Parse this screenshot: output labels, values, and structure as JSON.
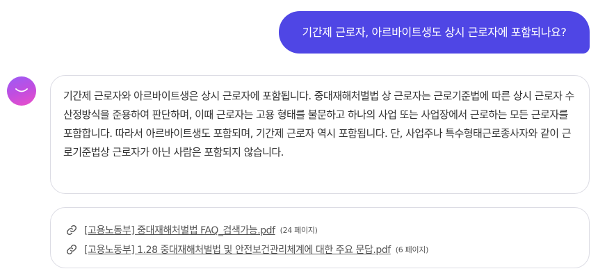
{
  "user_message": "기간제 근로자, 아르바이트생도 상시 근로자에 포함되나요?",
  "assistant": {
    "avatar_icon": "smile-icon",
    "answer": "기간제 근로자와 아르바이트생은 상시 근로자에 포함됩니다. 중대재해처벌법 상 근로자는 근로기준법에 따른 상시 근로자 수 산정방식을 준용하여 판단하며, 이때 근로자는 고용 형태를 불문하고 하나의 사업 또는 사업장에서 근로하는 모든 근로자를 포함합니다. 따라서 아르바이트생도 포함되며, 기간제 근로자 역시 포함됩니다. 단, 사업주나 특수형태근로종사자와 같이 근로기준법상 근로자가 아닌 사람은 포함되지 않습니다."
  },
  "sources": [
    {
      "title": "[고용노동부] 중대재해처벌법 FAQ_검색가능.pdf",
      "pages": "(24 페이지)",
      "icon": "link-icon"
    },
    {
      "title": "[고용노동부] 1.28 중대재해처벌법 및 안전보건관리체계에 대한 주요 문답.pdf",
      "pages": "(6 페이지)",
      "icon": "link-icon"
    }
  ],
  "colors": {
    "user_bubble": "#4f46e5",
    "avatar_gradient": [
      "#9b5cf6",
      "#ec4fc9"
    ],
    "card_border": "#dcdce4"
  }
}
